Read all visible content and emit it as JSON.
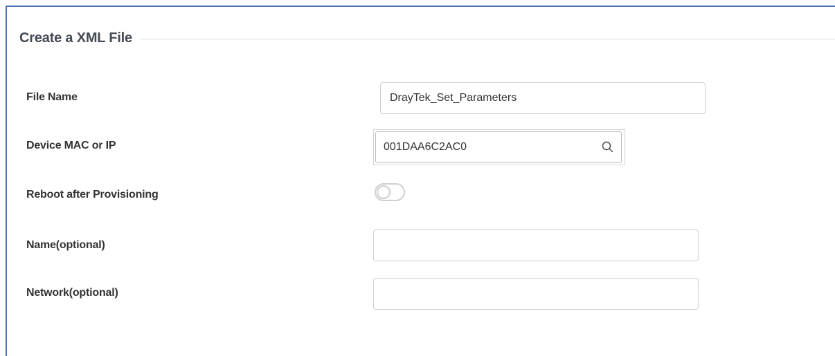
{
  "section": {
    "title": "Create a XML File"
  },
  "fields": {
    "file_name": {
      "label": "File Name",
      "value": "DrayTek_Set_Parameters"
    },
    "device": {
      "label": "Device MAC or IP",
      "value": "001DAA6C2AC0",
      "icon": "search-icon"
    },
    "reboot": {
      "label": "Reboot after Provisioning",
      "checked": false
    },
    "name": {
      "label": "Name(optional)",
      "value": ""
    },
    "network": {
      "label": "Network(optional)",
      "value": ""
    }
  },
  "colors": {
    "panel_border": "#4a6fb5",
    "input_border": "#cfcfcf",
    "toggle_off": "#cfcfcf"
  }
}
